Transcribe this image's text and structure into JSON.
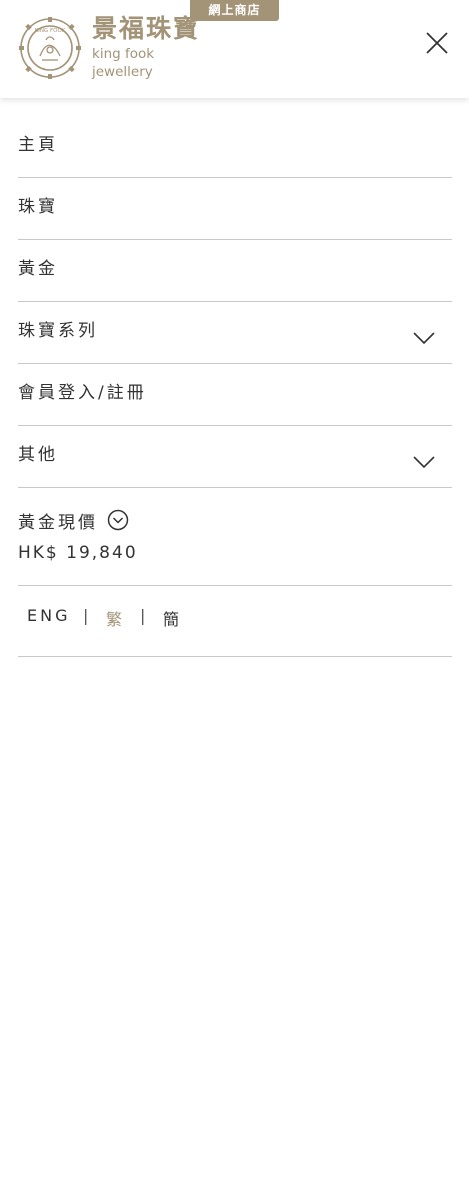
{
  "header": {
    "shop_badge": "網上商店",
    "logo_cn": "景福珠寶",
    "logo_en": "king fook jewellery",
    "logo_seal_text": "KING FOOK"
  },
  "menu": {
    "items": [
      {
        "label": "主頁"
      },
      {
        "label": "珠寶"
      },
      {
        "label": "黃金"
      },
      {
        "label": "珠寶系列"
      },
      {
        "label": "會員登入/註冊"
      },
      {
        "label": "其他"
      }
    ]
  },
  "gold_price": {
    "title": "黃金現價",
    "value": "HK$ 19,840"
  },
  "languages": {
    "eng": "ENG",
    "sep1": "|",
    "trad": "繁",
    "sep2": "|",
    "simp": "簡",
    "active": "繁"
  },
  "colors": {
    "accent": "#a39377",
    "text": "#333333",
    "divider": "#c9c9c9"
  }
}
